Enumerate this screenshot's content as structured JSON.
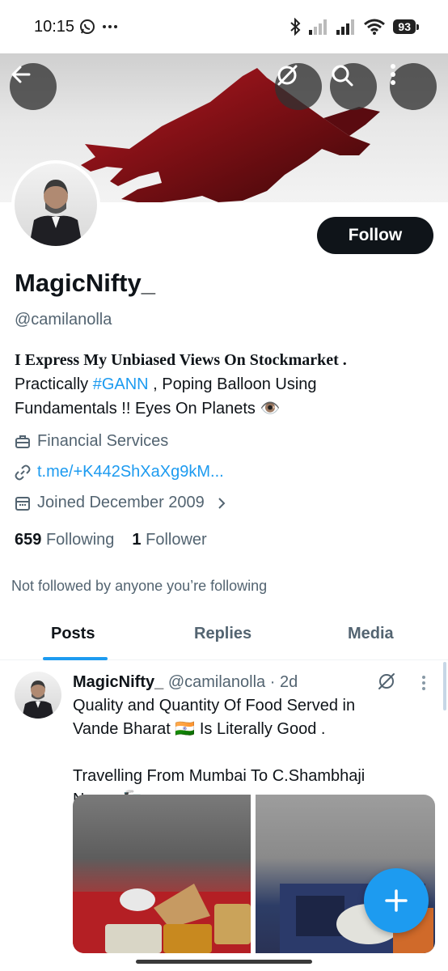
{
  "status_bar": {
    "time": "10:15",
    "battery": "93",
    "icons": [
      "whatsapp-icon",
      "more-dots-icon",
      "bluetooth-icon",
      "signal-icon",
      "signal-icon",
      "wifi-icon",
      "battery-icon"
    ]
  },
  "header": {
    "back_icon": "arrow-left-icon",
    "grok_icon": "grok-icon",
    "search_icon": "search-icon",
    "more_icon": "more-vertical-icon"
  },
  "profile": {
    "display_name": "MagicNifty_",
    "handle": "@camilanolla",
    "follow_label": "Follow",
    "bio_serif": "I Express My Unbiased Views On Stockmarket .",
    "bio_line2_prefix": "Practically ",
    "bio_hashtag": "#GANN",
    "bio_line2_suffix": " , Poping Balloon Using",
    "bio_line3": "Fundamentals !! Eyes On Planets 👁️",
    "category": "Financial Services",
    "link": "t.me/+K442ShXaXg9kM...",
    "joined": "Joined December 2009",
    "following_count": "659",
    "following_label": "Following",
    "followers_count": "1",
    "followers_label": "Follower",
    "not_followed": "Not followed by anyone you’re following"
  },
  "tabs": [
    {
      "label": "Posts",
      "active": true
    },
    {
      "label": "Replies",
      "active": false
    },
    {
      "label": "Media",
      "active": false
    }
  ],
  "tweet": {
    "author": "MagicNifty_",
    "handle": "@camilanolla",
    "separator": "·",
    "time": "2d",
    "line1": "Quality and Quantity Of Food Served in",
    "line2": "Vande Bharat 🇮🇳 Is Literally Good .",
    "line3": "Travelling From Mumbai To C.Shambhaji",
    "line4": "Nagar 🚂"
  },
  "colors": {
    "accent": "#1d9bf0",
    "text_primary": "#0f1419",
    "text_secondary": "#536471",
    "follow_bg": "#0f1419"
  }
}
